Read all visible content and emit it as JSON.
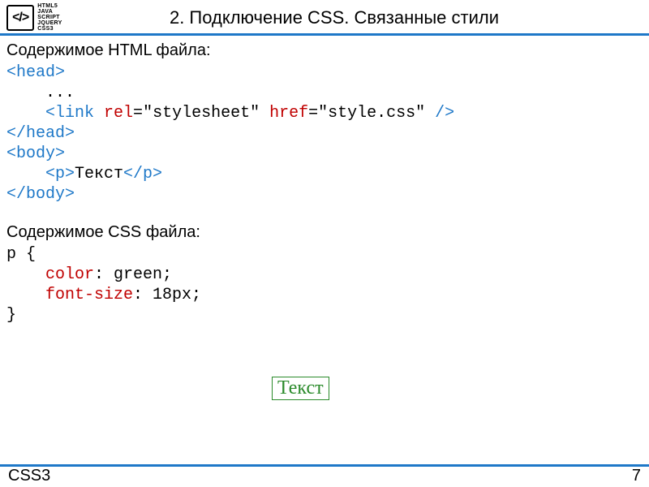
{
  "logo": {
    "symbol": "</>",
    "lines": [
      "HTML5",
      "JAVA SCRIPT",
      "JQUERY",
      "CSS3"
    ]
  },
  "title": "2. Подключение CSS. Связанные стили",
  "html_section_label": "Содержимое HTML файла:",
  "css_section_label": "Содержимое CSS файла:",
  "code": {
    "head_open": "<head>",
    "ellipsis": "    ...",
    "indent": "    ",
    "link_open": "<link ",
    "rel_attr": "rel",
    "eq": "=",
    "rel_val": "\"stylesheet\"",
    "sp": " ",
    "href_attr": "href",
    "href_val": "\"style.css\"",
    "link_close": " />",
    "head_close": "</head>",
    "body_open": "<body>",
    "p_open": "<p>",
    "p_text": "Текст",
    "p_close": "</p>",
    "body_close": "</body>"
  },
  "css": {
    "selector_open": "p {",
    "color_prop": "color",
    "color_rest": ": green;",
    "fs_prop": "font-size",
    "fs_rest": ": 18px;",
    "close": "}",
    "indent": "    "
  },
  "result_text": "Текст",
  "footer": {
    "left": "CSS3",
    "right": "7"
  }
}
